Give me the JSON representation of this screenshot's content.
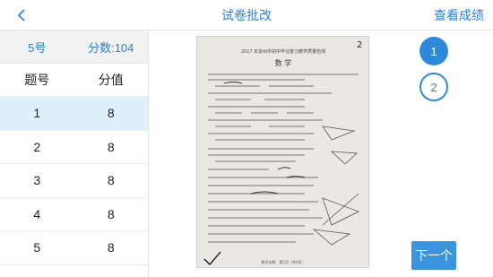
{
  "header": {
    "title": "试卷批改",
    "view_scores": "查看成绩"
  },
  "student": {
    "number": "5号",
    "score": "分数:104"
  },
  "table": {
    "columns": [
      "题号",
      "分值"
    ],
    "rows": [
      {
        "no": "1",
        "score": "8"
      },
      {
        "no": "2",
        "score": "8"
      },
      {
        "no": "3",
        "score": "8"
      },
      {
        "no": "4",
        "score": "8"
      },
      {
        "no": "5",
        "score": "8"
      }
    ],
    "selected_index": 0
  },
  "paper": {
    "heading": "2017 年泉州市初中毕业复习教学质量检测",
    "subject": "数 学",
    "corner_mark": "2",
    "footer": "数学试题　第1页（共6页）"
  },
  "pages": [
    "1",
    "2"
  ],
  "active_page": "1",
  "next_label": "下一个",
  "colors": {
    "accent": "#2e7fd6",
    "selected_row": "#dff0fb",
    "button": "#3b95de"
  },
  "icons": {
    "back": "chevron-left-icon"
  }
}
